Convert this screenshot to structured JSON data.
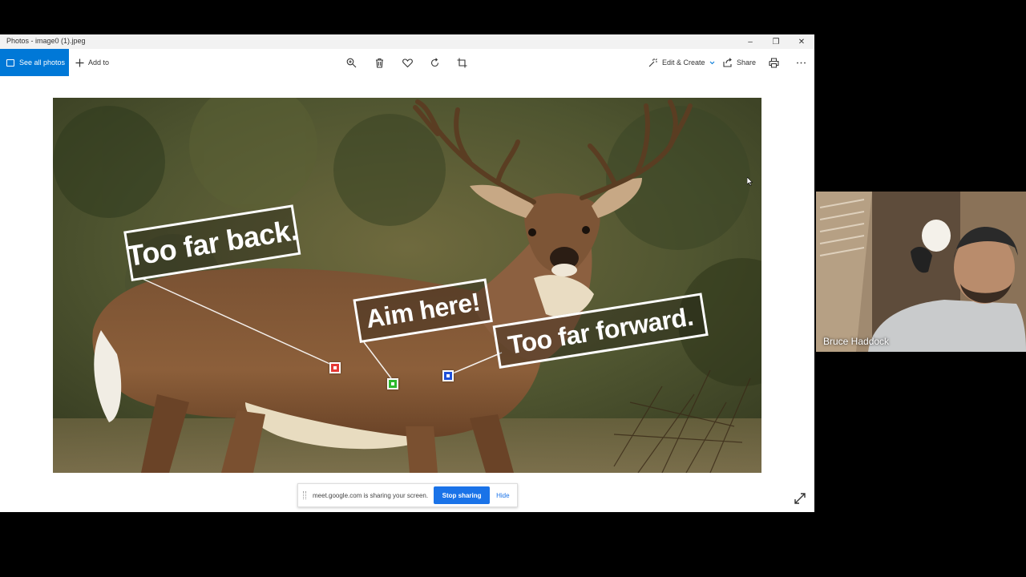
{
  "window": {
    "title": "Photos - image0 (1).jpeg",
    "controls": {
      "minimize": "–",
      "maximize": "❐",
      "close": "✕"
    }
  },
  "toolbar": {
    "see_all_photos": "See all photos",
    "add_to": "Add to",
    "edit_create": "Edit & Create",
    "share": "Share"
  },
  "photo": {
    "callouts": {
      "back": "Too far back.",
      "aim": "Aim here!",
      "forward": "Too far forward."
    },
    "marker_colors": {
      "back": "#e53935",
      "aim": "#2eb82e",
      "forward": "#1e4fd8"
    }
  },
  "share_bar": {
    "message": "meet.google.com is sharing your screen.",
    "stop_label": "Stop sharing",
    "hide_label": "Hide"
  },
  "participant": {
    "name": "Bruce Haddock"
  },
  "colors": {
    "accent": "#0078d7",
    "meet_blue": "#1a73e8"
  }
}
